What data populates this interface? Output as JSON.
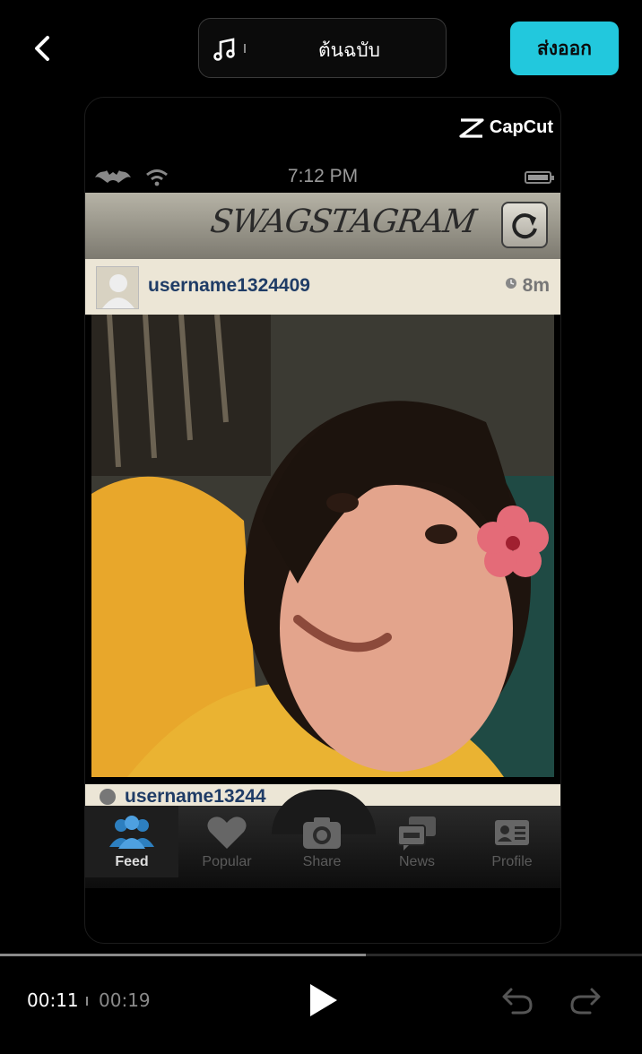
{
  "topbar": {
    "back_icon": "chevron-left-icon",
    "template_label": "ต้นฉบับ",
    "music_icon": "music-note-icon",
    "export_label": "ส่งออก",
    "accent_color": "#22c8dd"
  },
  "preview": {
    "watermark": "CapCut",
    "status_time": "7:12 PM",
    "app_logo": "SWAGSTAGRAM",
    "post": {
      "username": "username1324409",
      "time_ago": "8m"
    },
    "next_post_username": "username13244",
    "tabs": [
      {
        "label": "Feed",
        "icon": "people-icon",
        "active": true
      },
      {
        "label": "Popular",
        "icon": "heart-icon",
        "active": false
      },
      {
        "label": "Share",
        "icon": "camera-icon",
        "active": false
      },
      {
        "label": "News",
        "icon": "chat-bubbles-icon",
        "active": false
      },
      {
        "label": "Profile",
        "icon": "id-card-icon",
        "active": false
      }
    ]
  },
  "playback": {
    "current_time": "00:11",
    "total_time": "00:19",
    "progress_fraction": 0.57
  }
}
